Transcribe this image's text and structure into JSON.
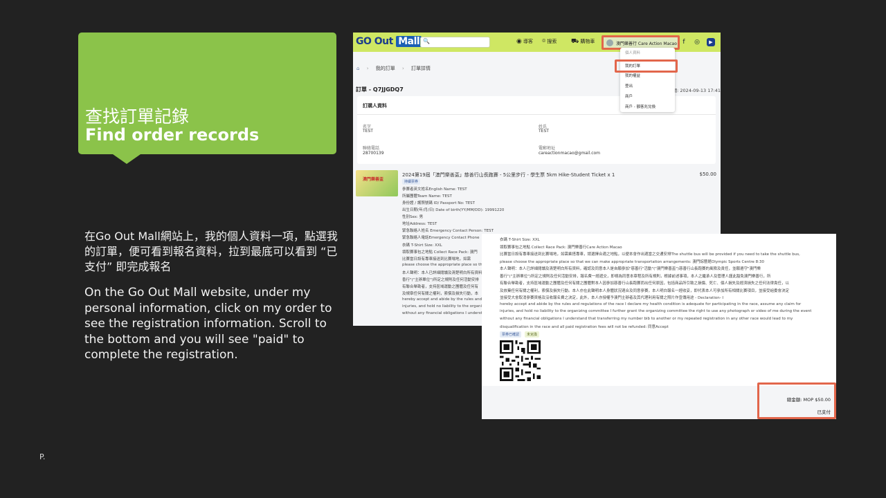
{
  "slide": {
    "title_zh": "查找訂單記錄",
    "title_en": "Find order records",
    "desc_zh": "在Go Out Mall網站上，我的個人資料一項，點選我的訂單，便可看到報名資料，拉到最底可以看到 “已支付” 即完成報名",
    "desc_en": "On the Go Out Mall website, under my personal information, click on my order to see the registration information. Scroll to the bottom and you will see \"paid\" to complete the registration.",
    "page_label": "P."
  },
  "shot1": {
    "logo_go": "GO Out",
    "logo_mall": "Mall",
    "nav": [
      "導客",
      "搜索",
      "購物車"
    ],
    "user_name": "澳門樂善行 Care Action Macao",
    "dropdown": [
      "個人資料",
      "我的訂單",
      "我的權益",
      "登出",
      "商戶",
      "商戶 - 額客兆兌換"
    ],
    "breadcrumb": [
      "我的訂單",
      "訂單詳情"
    ],
    "order_no": "訂單 - Q7JJGDQ7",
    "order_date": "訂單日期: 2024-09-13 17:41",
    "buyer": {
      "heading": "訂購人資料",
      "first_name_label": "名字",
      "first_name": "TEST",
      "last_name_label": "姓氏",
      "last_name": "TEST",
      "phone_label": "聯絡電話",
      "phone": "28700139",
      "email_label": "電郵地址",
      "email": "careactionmacao@gmail.com"
    },
    "product": {
      "title": "2024第19屆「澳門樂善盃」慈善行山長跑賽 - 5公里步行 - 學生票 5km Hike-Student Ticket x 1",
      "price": "$50.00",
      "badge": "持續票券",
      "image_text": "澳門樂善盃",
      "lines": [
        "參賽者英文姓名English Name: TEST",
        "所屬團體Team Name: TEST",
        "身份證 / 護照號碼 ID/ Passport No: TEST",
        "出生日期(年/月/日) Date of birth(YY/MM/DD): 19991220",
        "性別Sex: 男",
        "地址Address: TEST",
        "緊急聯絡人姓名 Emergency Contact Person: TEST",
        "緊急聯絡人電話Emergency Contact Phone",
        "衣碼 T-Shirt Size: XXL",
        "領取賽事包之地點 Collect Race Pack: 澳門",
        "比賽當日設有專車接送到比賽場地，如需",
        "please choose the appropriate place so th",
        "本人聲明：本人已詳細閱讀及清楚明白所有資料",
        "香行\"(\"主辦單位\")所定之規則及任何活動安排",
        "有聯合舉勘者，支持區域運動之團體及任何有",
        "及規章任何有關之權利，索償及損失行動，本",
        "hereby accept and abide by the rules and",
        "injuries, and hold no liability to the organiz",
        "without any financial obligations I underst"
      ]
    }
  },
  "shot2": {
    "lines": [
      "衣碼 T-Shirt Size: XXL",
      "領取賽事包之地點 Collect Race Pack: 澳門樂善行Care Action Macao",
      "比賽當日設有專車接送到比賽場地，如需乘搭專車，請選擇合適之地點，以便本會作出適當之交通安排The shuttle bus will be provided if you need to take the shuttle bus,",
      "please choose the appropriate place so that we can make appropriate transportation arrangements: 澳門綜藝館Olympic Sports Centre 8:30",
      "本人聲明：本人已詳細閱讀及清楚明白所有資料，確認及同意本人是自願參加\"慈善行\"活動\"(\"澳門樂善盃\")慈善行山長跑賽的風險及責任，並願遵守\"澳門樂",
      "善行\"(\"主辦單位\")所定之規則及任何活動安排，報名費一經遞交，即視為同意本章程及所有規則，根據前述事項，本人之繼承人及管理人謹此豁免澳門樂善行，所",
      "有聯合舉勘者，支持區域運動之團體及任何有關之團體對本人因參加慈善行山長跑賽而出任何原因，包括商品所引致之損傷、死亡、個人損失及經濟損失之任何法律責任，以",
      "及放棄任何有關之權利，索償及損失行動。本人亦在此聲明本人身體狀況適合及同意參賽，本人明白報名一經收妥，即代表本人可參加所有相關比賽項目，並接受組委會決定",
      "並接受大會取消參賽資格及沒收報名費之決定，此外，本人亦授權予澳門主辦者及其代理利用有關之照片作宣傳用途 - Declaration- I",
      "hereby accept and abide by the rules and regulations of the race I declare my health condition is adequate for participating in the race, assume any claim for",
      "injuries, and hold no liability to the organizing committee I further grant the organizing committee the right to use any photograph or video of me during the event",
      "without any financial obligations I understand that transferring my number bib to another or my repeated registration in any other race would lead to my",
      "disqualification in the race and all paid registration fees will not be refunded: 同意Accept"
    ],
    "badges": [
      "票券已確認",
      "未兌換"
    ],
    "total": "總金額: MOP $50.00",
    "status": "已支付"
  },
  "colors": {
    "background": "#222222",
    "callout": "#8bc34a",
    "highlight": "#e2664b",
    "site_header": "#cfe763"
  },
  "icons": [
    "search-icon",
    "camera-icon",
    "location-icon",
    "cart-icon",
    "facebook-icon",
    "instagram-icon",
    "youtube-icon",
    "home-icon",
    "qr-code"
  ]
}
